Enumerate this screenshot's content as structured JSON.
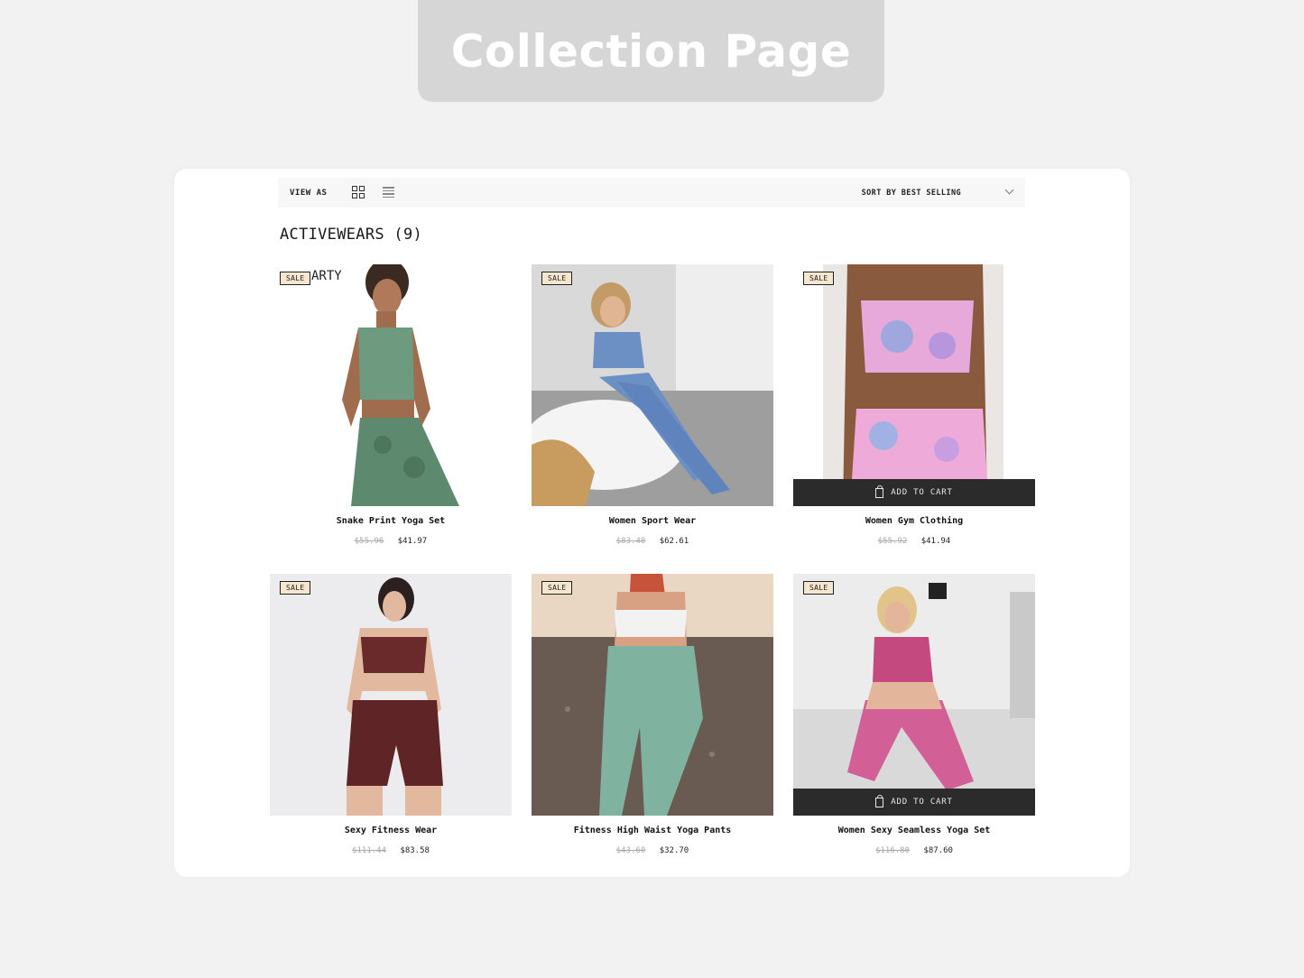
{
  "banner": {
    "title": "Collection Page"
  },
  "toolbar": {
    "view_as": "VIEW AS",
    "sort_label": "SORT BY BEST SELLING"
  },
  "collection": {
    "title": "ACTIVEWEARS (9)",
    "overlap_text": "ARTY"
  },
  "products": [
    {
      "name": "Snake Print Yoga Set",
      "old_price": "$55.96",
      "price": "$41.97",
      "badge": "SALE",
      "cart_label": ""
    },
    {
      "name": "Women Sport Wear",
      "old_price": "$83.48",
      "price": "$62.61",
      "badge": "SALE",
      "cart_label": ""
    },
    {
      "name": "Women Gym Clothing",
      "old_price": "$55.92",
      "price": "$41.94",
      "badge": "SALE",
      "cart_label": "ADD TO CART"
    },
    {
      "name": "Sexy Fitness Wear",
      "old_price": "$111.44",
      "price": "$83.58",
      "badge": "SALE",
      "cart_label": ""
    },
    {
      "name": "Fitness High Waist Yoga Pants",
      "old_price": "$43.60",
      "price": "$32.70",
      "badge": "SALE",
      "cart_label": ""
    },
    {
      "name": "Women Sexy Seamless Yoga Set",
      "old_price": "$116.80",
      "price": "$87.60",
      "badge": "SALE",
      "cart_label": "ADD TO CART"
    }
  ],
  "colors": {
    "page_bg": "#f2f2f2",
    "banner_bg": "#d6d6d6",
    "badge_bg": "#f5e6cf",
    "cart_bar": "#2b2b2b"
  },
  "icons": [
    "grid-view-icon",
    "list-view-icon",
    "chevron-down-icon",
    "shopping-bag-icon"
  ]
}
